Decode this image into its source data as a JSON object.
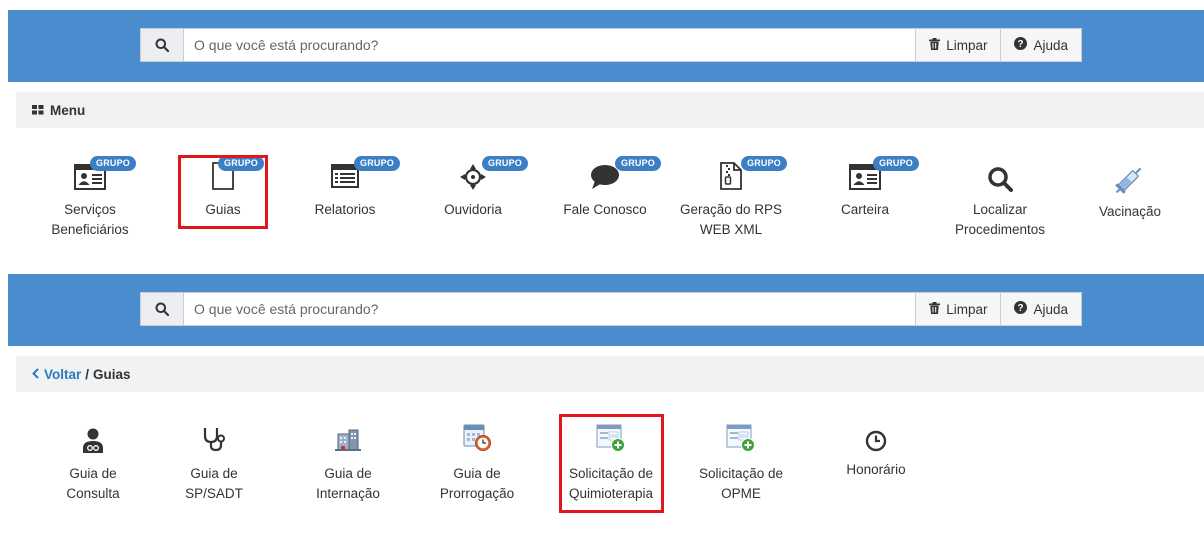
{
  "panel1": {
    "search": {
      "placeholder": "O que você está procurando?",
      "limpar_label": "Limpar",
      "ajuda_label": "Ajuda"
    },
    "menu_title": "Menu",
    "badge_text": "GRUPO",
    "tiles": [
      {
        "label": "Serviços Beneficiários",
        "icon": "id-card-icon",
        "badge": true
      },
      {
        "label": "Guias",
        "icon": "document-icon",
        "badge": true,
        "highlighted": true
      },
      {
        "label": "Relatorios",
        "icon": "list-window-icon",
        "badge": true
      },
      {
        "label": "Ouvidoria",
        "icon": "crosshairs-icon",
        "badge": true
      },
      {
        "label": "Fale Conosco",
        "icon": "speech-bubble-icon",
        "badge": true
      },
      {
        "label": "Geração do RPS WEB XML",
        "icon": "zip-file-icon",
        "badge": true
      },
      {
        "label": "Carteira",
        "icon": "id-card-icon",
        "badge": true
      },
      {
        "label": "Localizar Procedimentos",
        "icon": "search-icon",
        "badge": false
      },
      {
        "label": "Vacinação",
        "icon": "syringe-icon",
        "badge": false
      }
    ]
  },
  "panel2": {
    "search": {
      "placeholder": "O que você está procurando?",
      "limpar_label": "Limpar",
      "ajuda_label": "Ajuda"
    },
    "breadcrumb": {
      "back_label": "Voltar",
      "separator": "/",
      "current": "Guias"
    },
    "tiles": [
      {
        "label": "Guia de Consulta",
        "icon": "doctor-icon"
      },
      {
        "label": "Guia de SP/SADT",
        "icon": "stethoscope-icon"
      },
      {
        "label": "Guia de Internação",
        "icon": "hospital-icon"
      },
      {
        "label": "Guia de Prorrogação",
        "icon": "calendar-clock-icon"
      },
      {
        "label": "Solicitação de Quimioterapia",
        "icon": "form-add-icon",
        "highlighted": true
      },
      {
        "label": "Solicitação de OPME",
        "icon": "form-add-icon"
      },
      {
        "label": "Honorário",
        "icon": "clock-icon"
      }
    ]
  },
  "colors": {
    "topbar": "#4a8ccd",
    "badge": "#3d7fc4",
    "highlight": "#e3151d",
    "link": "#2e78c2"
  }
}
